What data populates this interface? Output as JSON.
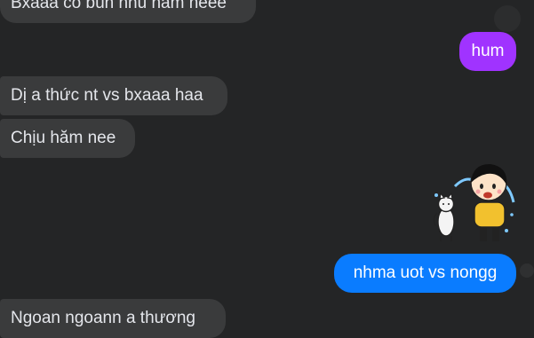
{
  "messages": [
    {
      "id": "m1",
      "direction": "incoming",
      "text": "Bxaaa có bùn nhu nam neee"
    },
    {
      "id": "m2",
      "direction": "outgoing",
      "text": "hum",
      "color": "#a033ff"
    },
    {
      "id": "m3",
      "direction": "incoming",
      "text": "Dị a thức nt vs bxaaa haa"
    },
    {
      "id": "m4",
      "direction": "incoming",
      "text": "Chịu hăm nee"
    },
    {
      "id": "m5",
      "direction": "outgoing",
      "sticker": "crying-kid-and-cat-sticker"
    },
    {
      "id": "m6",
      "direction": "outgoing",
      "text": "nhma uot vs nongg",
      "color": "#0a7cff"
    },
    {
      "id": "m7",
      "direction": "incoming",
      "text": "Ngoan ngoann a thương"
    }
  ],
  "colors": {
    "background": "#242526",
    "incoming_bubble": "#3a3b3c",
    "outgoing_purple": "#a033ff",
    "outgoing_blue": "#0a7cff"
  },
  "icons": {
    "scroll": "scroll-down-icon",
    "sticker": "crying-kid-and-cat-sticker",
    "read_receipt": "read-receipt-icon"
  }
}
